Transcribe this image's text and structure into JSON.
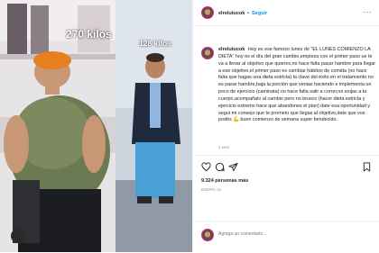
{
  "photo": {
    "before_weight": "270 kilos",
    "after_weight": "128 kilos"
  },
  "post": {
    "username": "elrelutucok",
    "separator": "•",
    "follow_label": "Seguir",
    "more_label": "···",
    "caption": "Hoy es ese famoso lunes de \"EL LUNES COMIENZO LA DIETA\" hoy es el día del gran cambio,empieza con el primer paso ue te va a llevar al objetivo que quieres,no hace falta pasar hambre para llegar a ese objetivo,el primer paso es cambiar hábitos de comida (no hace falta que hagas una dieta estricta) la clave del éxito en el tratamiento no es pasar hambre,baja la porción que venias haciendo e implementa un poco de ejercicio (caminata) no hace falta salir a correr,no exijas a tu cuerpo,acompañalo al cambio pero no brusco (hacer dieta estricta y ejercicio extremo hace que abandones el plan) date esa oportunidad y seguí mi consejo que te prometo que llegas al objetivo,date que vos podés 💪 buen comienzo de semana super bendecido.",
    "time_ago": "1 sem",
    "likes": "9.324 personas más",
    "date": "ENERO 31",
    "comment_placeholder": "Agrega un comentario...",
    "icons": {
      "like": "heart-icon",
      "comment": "comment-icon",
      "share": "share-icon",
      "save": "bookmark-icon"
    }
  }
}
